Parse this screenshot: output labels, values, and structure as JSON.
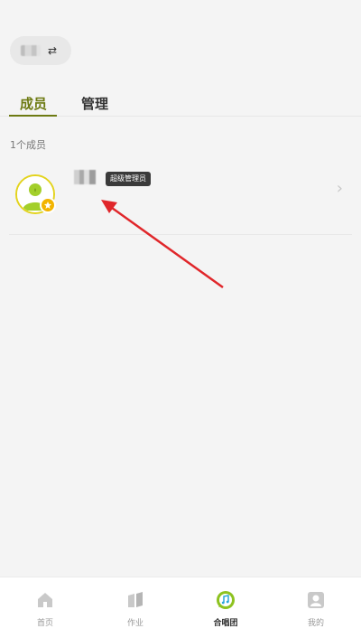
{
  "header": {
    "switch_icon": "⇄",
    "group_name": ""
  },
  "tabs": [
    {
      "label": "成员",
      "active": true
    },
    {
      "label": "管理",
      "active": false
    }
  ],
  "member_count": "1个成员",
  "members": [
    {
      "name": "",
      "role": "超级管理员",
      "avatar_icon": "user-avatar-icon",
      "badge_icon": "crown-icon"
    }
  ],
  "nav": [
    {
      "label": "首页",
      "icon": "home-icon",
      "active": false
    },
    {
      "label": "作业",
      "icon": "book-icon",
      "active": false
    },
    {
      "label": "合唱团",
      "icon": "music-chat-icon",
      "active": true
    },
    {
      "label": "我的",
      "icon": "profile-icon",
      "active": false
    }
  ],
  "colors": {
    "accent": "#6d7a12",
    "avatar_ring": "#e3d31c",
    "music_green": "#8dc21f",
    "arrow": "#e0262a"
  }
}
